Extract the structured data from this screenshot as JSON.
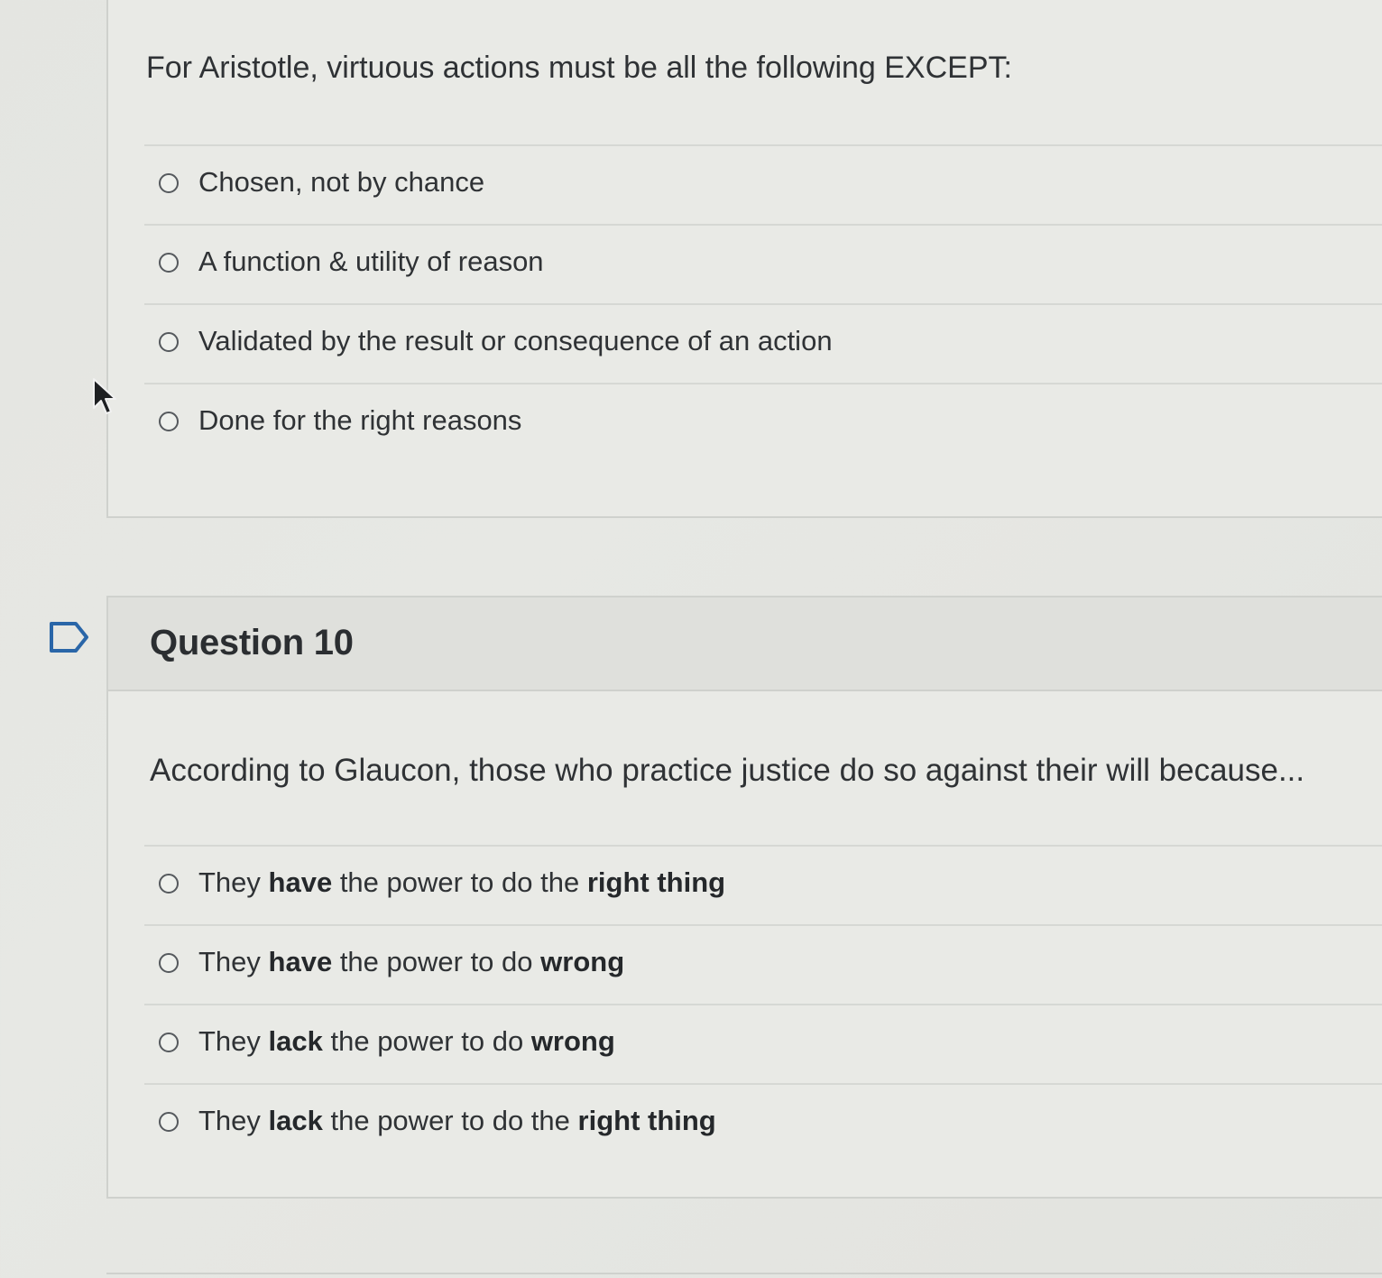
{
  "q9": {
    "text": "For Aristotle, virtuous actions must be all the following EXCEPT:",
    "answers": [
      {
        "label": "Chosen, not by chance"
      },
      {
        "label": "A function & utility of reason"
      },
      {
        "label": "Validated by the result or consequence of an action"
      },
      {
        "label": "Done for the right reasons"
      }
    ]
  },
  "q10": {
    "title": "Question 10",
    "text": "According to Glaucon, those who practice justice do so against their will because...",
    "answers": [
      {
        "w1": "They ",
        "b1": "have",
        "w2": " the power to do the ",
        "b2": "right thing"
      },
      {
        "w1": "They ",
        "b1": "have",
        "w2": " the power to do ",
        "b2": "wrong"
      },
      {
        "w1": "They ",
        "b1": "lack",
        "w2": " the power to do ",
        "b2": "wrong"
      },
      {
        "w1": "They ",
        "b1": "lack",
        "w2": " the power to do the ",
        "b2": "right thing"
      }
    ]
  },
  "icons": {
    "flag": "flag-question-icon",
    "cursor": "mouse-pointer-icon"
  },
  "colors": {
    "background": "#e5e6e2",
    "card": "#e9eae6",
    "header": "#dfe0dc",
    "text": "#2f3235"
  }
}
